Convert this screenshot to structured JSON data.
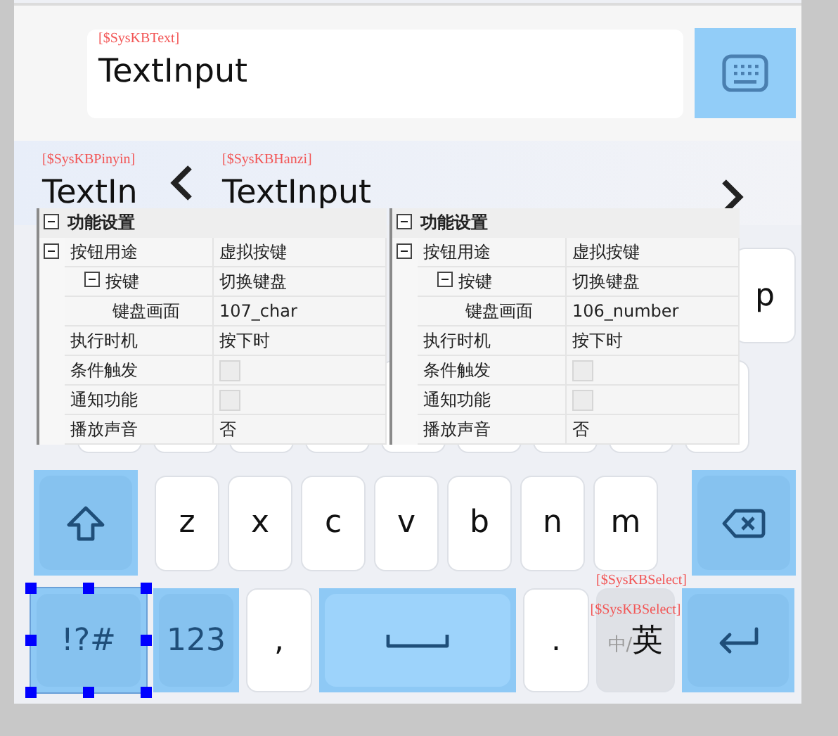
{
  "input_bar": {
    "tag": "[$SysKBText]",
    "value": "TextInput"
  },
  "candidate_bar": {
    "pinyin_tag": "[$SysKBPinyin]",
    "pinyin": "TextIn",
    "hanzi_tag": "[$SysKBHanzi]",
    "hanzi": "TextInput"
  },
  "row_1": [
    {
      "label": "p"
    }
  ],
  "row_3": [
    {
      "kind": "shift"
    },
    {
      "kind": "letter",
      "label": "z"
    },
    {
      "kind": "letter",
      "label": "x"
    },
    {
      "kind": "letter",
      "label": "c"
    },
    {
      "kind": "letter",
      "label": "v"
    },
    {
      "kind": "letter",
      "label": "b"
    },
    {
      "kind": "letter",
      "label": "n"
    },
    {
      "kind": "letter",
      "label": "m"
    },
    {
      "kind": "backspace"
    }
  ],
  "row_4": [
    {
      "kind": "function",
      "label": "!?#",
      "selected": true
    },
    {
      "kind": "function",
      "label": "123",
      "selected": false
    },
    {
      "kind": "letter",
      "label": ",",
      "selected": false
    },
    {
      "kind": "space",
      "selected": false
    },
    {
      "kind": "letter",
      "label": ".",
      "selected": false
    },
    {
      "kind": "lang",
      "tags": [
        "[$SysKBSelect]",
        "[$SysKBSelect]"
      ],
      "dim": "中/",
      "label": "英",
      "selected": false
    },
    {
      "kind": "enter",
      "selected": false
    }
  ],
  "property_panels": [
    {
      "title": "功能设置",
      "expanded": true,
      "rows": [
        {
          "kind": "text",
          "label": "按钮用途",
          "value": "虚拟按键",
          "expanded": true,
          "children": [
            {
              "kind": "text",
              "label": "按键",
              "value": "切换键盘",
              "expanded": true,
              "children": [
                {
                  "kind": "text",
                  "label": "键盘画面",
                  "value": "107_char"
                }
              ]
            }
          ]
        },
        {
          "kind": "text",
          "label": "执行时机",
          "value": "按下时"
        },
        {
          "kind": "checkbox",
          "label": "条件触发",
          "checked": false
        },
        {
          "kind": "checkbox",
          "label": "通知功能",
          "checked": false
        },
        {
          "kind": "text",
          "label": "播放声音",
          "value": "否"
        }
      ]
    },
    {
      "title": "功能设置",
      "expanded": true,
      "rows": [
        {
          "kind": "text",
          "label": "按钮用途",
          "value": "虚拟按键",
          "expanded": true,
          "children": [
            {
              "kind": "text",
              "label": "按键",
              "value": "切换键盘",
              "expanded": true,
              "children": [
                {
                  "kind": "text",
                  "label": "键盘画面",
                  "value": "106_number"
                }
              ]
            }
          ]
        },
        {
          "kind": "text",
          "label": "执行时机",
          "value": "按下时"
        },
        {
          "kind": "checkbox",
          "label": "条件触发",
          "checked": false
        },
        {
          "kind": "checkbox",
          "label": "通知功能",
          "checked": false
        },
        {
          "kind": "text",
          "label": "播放声音",
          "value": "否"
        }
      ]
    }
  ]
}
